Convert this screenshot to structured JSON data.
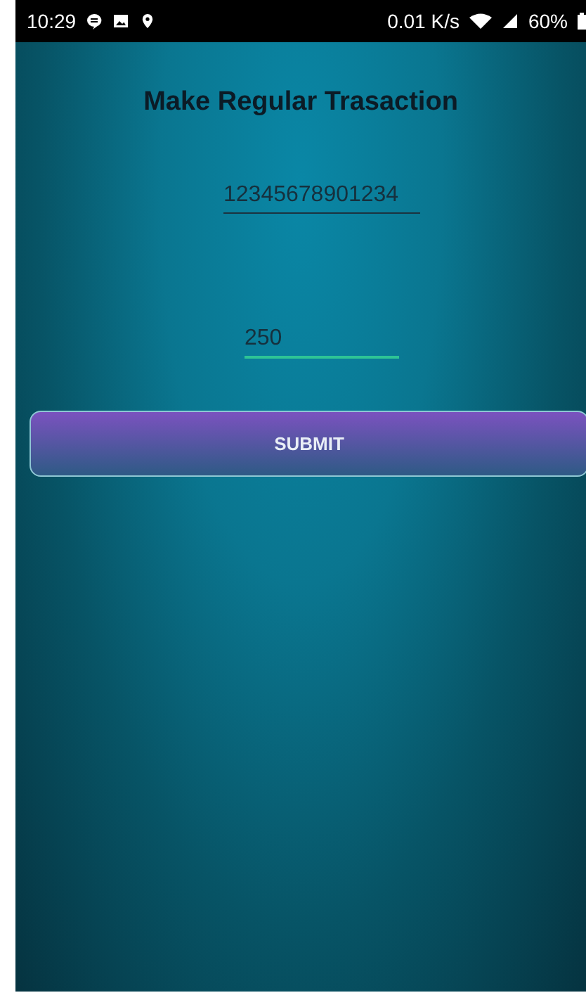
{
  "status_bar": {
    "time": "10:29",
    "speed": "0.01 K/s",
    "battery": "60%"
  },
  "title": "Make Regular Trasaction",
  "fields": [
    {
      "value": "12345678901234",
      "focused": false
    },
    {
      "value": "250",
      "focused": true
    }
  ],
  "submit_button": "SUBMIT"
}
